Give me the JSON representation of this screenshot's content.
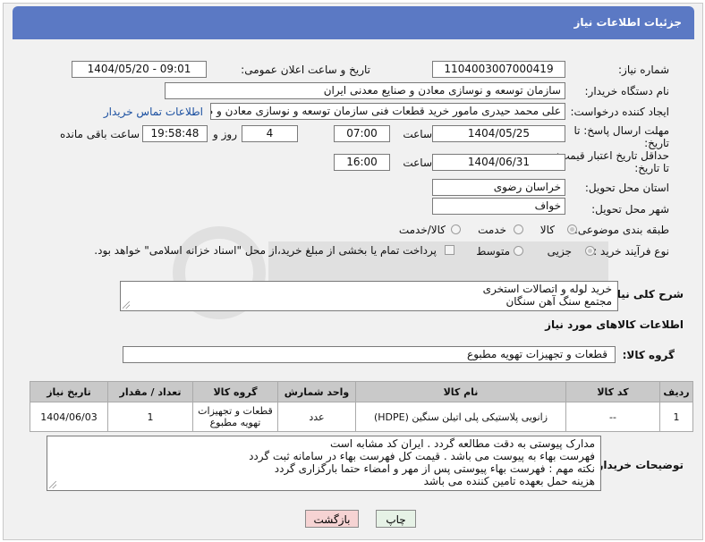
{
  "header": {
    "title": "جزئیات اطلاعات نیاز"
  },
  "fields": {
    "need_number_label": "شماره نیاز:",
    "need_number": "1104003007000419",
    "announce_label": "تاریخ و ساعت اعلان عمومی:",
    "announce_value": "1404/05/20 - 09:01",
    "buyer_org_label": "نام دستگاه خریدار:",
    "buyer_org": "سازمان توسعه و نوسازی معادن و صنایع معدنی ایران",
    "creator_label": "ایجاد کننده درخواست:",
    "creator": "علی محمد حیدری مامور خرید قطعات فنی سازمان توسعه و نوسازی معادن و ص",
    "contact_link": "اطلاعات تماس خریدار",
    "deadline_label_1": "مهلت ارسال پاسخ: تا",
    "deadline_label_2": "تاریخ:",
    "deadline_date": "1404/05/25",
    "time_label": "ساعت",
    "deadline_time": "07:00",
    "days_value": "4",
    "days_label": "روز و",
    "remaining_time": "19:58:48",
    "remaining_label": "ساعت باقی مانده",
    "validity_label_1": "حداقل تاریخ اعتبار قیمت:",
    "validity_label_2": "تا تاریخ:",
    "validity_date": "1404/06/31",
    "validity_time": "16:00",
    "province_label": "استان محل تحویل:",
    "province": "خراسان رضوی",
    "city_label": "شهر محل تحویل:",
    "city": "خواف",
    "category_label": "طبقه بندی موضوعی:",
    "category_options": [
      "کالا",
      "خدمت",
      "کالا/خدمت"
    ],
    "process_label": "نوع فرآیند خرید :",
    "process_options": [
      "جزیی",
      "متوسط"
    ],
    "payment_note": "پرداخت تمام یا بخشی از مبلغ خرید،از محل \"اسناد خزانه اسلامی\" خواهد بود.",
    "summary_label": "شرح کلی نیاز:",
    "summary_lines": [
      "خرید لوله و اتصالات استخری",
      "مجتمع سنگ آهن سنگان"
    ],
    "goods_info_label": "اطلاعات کالاهای مورد نیاز",
    "goods_group_label": "گروه کالا:",
    "goods_group": "قطعات و تجهیزات تهویه مطبوع"
  },
  "table": {
    "headers": [
      "ردیف",
      "کد کالا",
      "نام کالا",
      "واحد شمارش",
      "گروه کالا",
      "تعداد / مقدار",
      "تاریخ نیاز"
    ],
    "rows": [
      [
        "1",
        "--",
        "زانویی پلاستیکی پلی اتیلن سنگین (HDPE)",
        "عدد",
        "قطعات و تجهیزات\nتهویه مطبوع",
        "1",
        "1404/06/03"
      ]
    ]
  },
  "buyer_notes": {
    "label": "توضیحات خریدار:",
    "lines": [
      "مدارک پیوستی به دقت مطالعه گردد . ایران کد مشابه است",
      "فهرست بهاء به پیوست می باشد . قیمت کل فهرست بهاء در سامانه ثبت گردد",
      "نکته مهم : فهرست بهاء پیوستی پس از مهر و امضاء حتما بارگزاری گردد",
      "هزینه حمل بعهده تامین کننده می باشد"
    ]
  },
  "buttons": {
    "print": "چاپ",
    "back": "بازگشت"
  },
  "colors": {
    "header": "#5b79c4",
    "back_button": "#f6d3d3",
    "print_button": "#e6f2e6"
  }
}
